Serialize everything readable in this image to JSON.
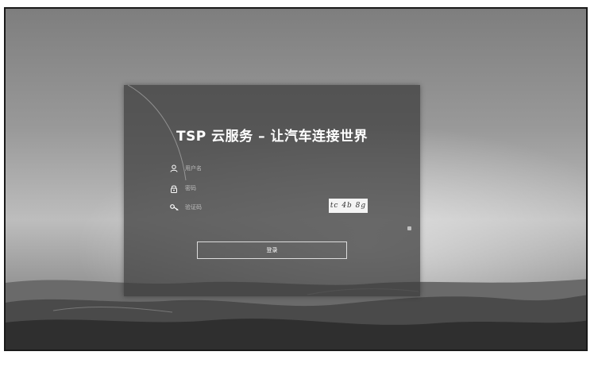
{
  "panel": {
    "title": "TSP 云服务 – 让汽车连接世界"
  },
  "form": {
    "username_placeholder": "用户名",
    "password_placeholder": "密码",
    "captcha_placeholder": "验证码",
    "captcha_text": "tc 4b 8g",
    "login_label": "登录"
  },
  "icons": {
    "username": "user-icon",
    "password": "lock-icon",
    "captcha": "key-icon"
  },
  "colors": {
    "panel_bg": "#3c3c3c",
    "text": "#ffffff",
    "button_border": "#dcdcdc"
  }
}
